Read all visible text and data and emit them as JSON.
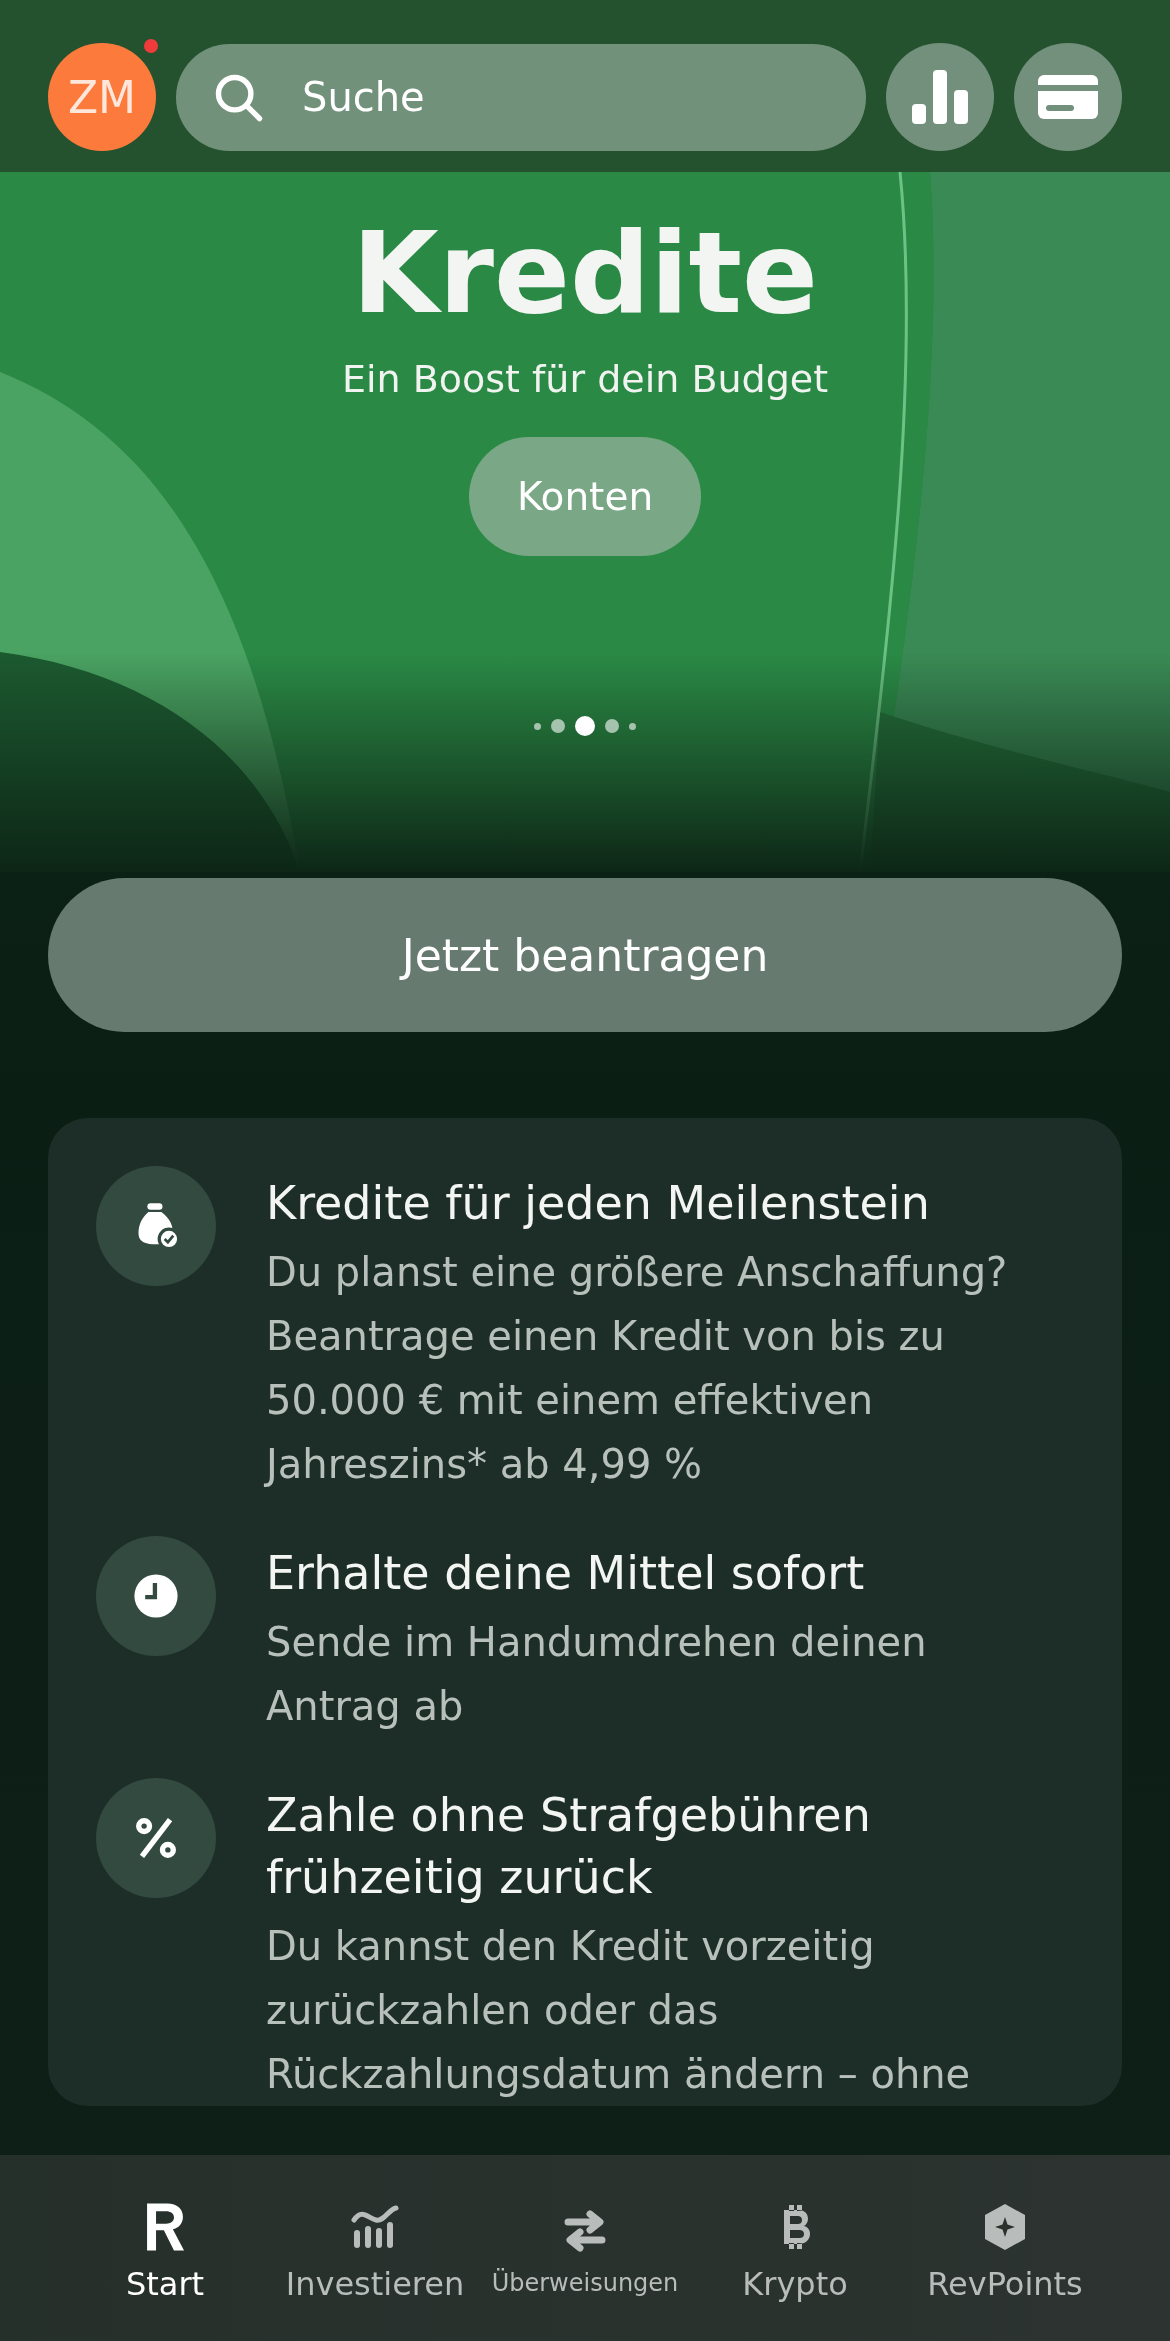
{
  "header": {
    "avatar": {
      "initials": "ZM",
      "notification": true
    },
    "search": {
      "placeholder": "Suche"
    }
  },
  "hero": {
    "title": "Kredite",
    "subtitle": "Ein Boost für dein Budget",
    "button": "Konten",
    "pages": [
      {
        "selected": false
      },
      {
        "selected": false
      },
      {
        "selected": true
      },
      {
        "selected": false
      },
      {
        "selected": false
      }
    ]
  },
  "apply_button": "Jetzt beantragen",
  "features": [
    {
      "kind": "money",
      "title": "Kredite für jeden Meilenstein",
      "text": "Du planst eine größere Anschaffung? Beantrage einen Kredit von bis zu 50.000 € mit einem effektiven Jahreszins* ab 4,99 %"
    },
    {
      "kind": "clock",
      "title": "Erhalte deine Mittel sofort",
      "text": "Sende im Handumdrehen deinen Antrag ab"
    },
    {
      "kind": "percent",
      "title": "Zahle ohne Strafgebühren frühzeitig zurück",
      "text": "Du kannst den Kredit vorzeitig zurückzahlen oder das Rückzahlungsdatum ändern – ohne"
    }
  ],
  "nav": [
    {
      "kind": "home",
      "label": "Start",
      "selected": true
    },
    {
      "kind": "invest",
      "label": "Investieren",
      "selected": false
    },
    {
      "kind": "transfer",
      "label": "Überweisungen",
      "selected": false
    },
    {
      "kind": "crypto",
      "label": "Krypto",
      "selected": false
    },
    {
      "kind": "points",
      "label": "RevPoints",
      "selected": false
    }
  ]
}
